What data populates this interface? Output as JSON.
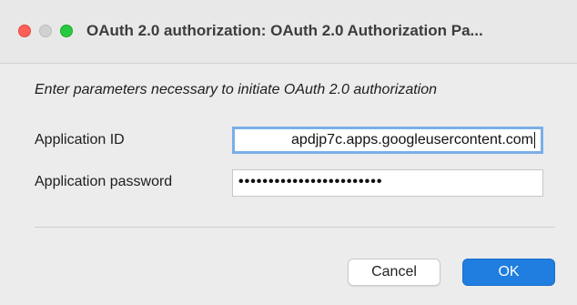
{
  "window": {
    "title": "OAuth 2.0 authorization: OAuth 2.0 Authorization Pa..."
  },
  "dialog": {
    "instructions": "Enter parameters necessary to initiate OAuth 2.0 authorization",
    "fields": {
      "application_id": {
        "label": "Application ID",
        "value": "apdjp7c.apps.googleusercontent.com"
      },
      "application_password": {
        "label": "Application password",
        "value": "••••••••••••••••••••••••"
      }
    },
    "buttons": {
      "cancel": "Cancel",
      "ok": "OK"
    }
  },
  "colors": {
    "close": "#fe5f57",
    "minimize": "#d1d1d1",
    "zoom": "#28c840",
    "focus_ring": "#7aaee8",
    "primary_button": "#1f7ee0"
  }
}
